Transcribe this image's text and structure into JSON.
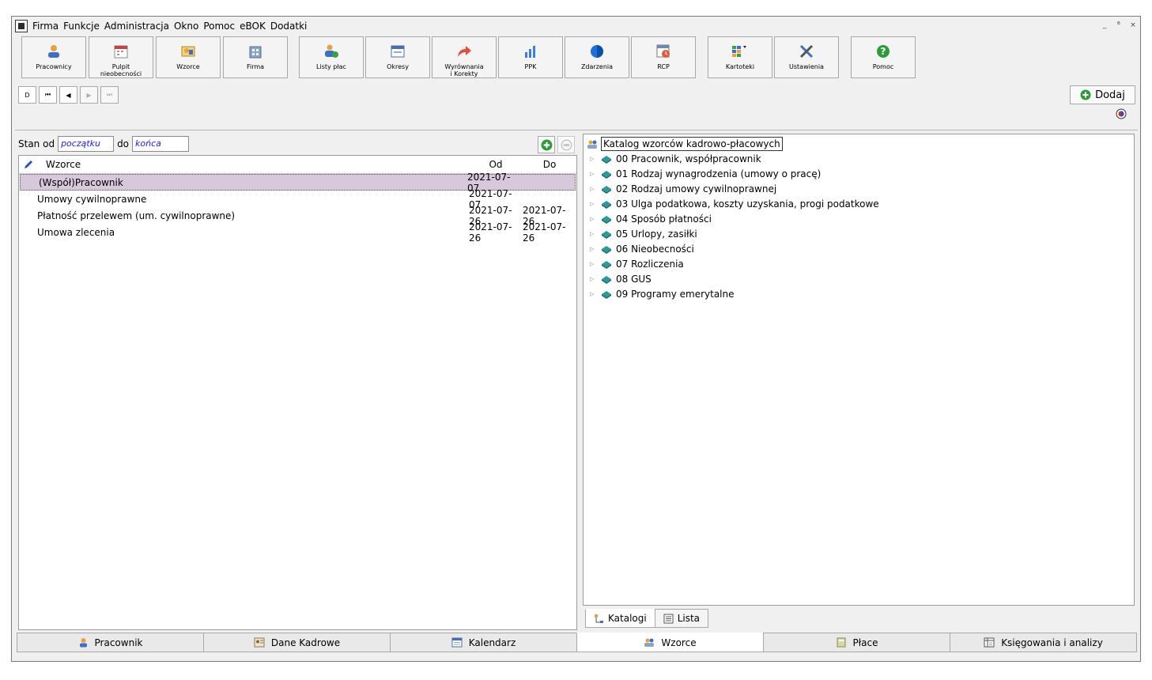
{
  "menu": [
    "Firma",
    "Funkcje",
    "Administracja",
    "Okno",
    "Pomoc",
    "eBOK",
    "Dodatki"
  ],
  "window_controls": [
    "_",
    "ᴮ",
    "×"
  ],
  "toolbar": [
    {
      "label": "Pracownicy",
      "icon": "person-icon"
    },
    {
      "label": "Pulpit\nnieobecności",
      "icon": "calendar-icon"
    },
    {
      "label": "Wzorce",
      "icon": "template-icon"
    },
    {
      "label": "Firma",
      "icon": "building-icon"
    },
    {
      "label": "Listy płac",
      "icon": "payroll-icon"
    },
    {
      "label": "Okresy",
      "icon": "window-icon"
    },
    {
      "label": "Wyrównania\ni Korekty",
      "icon": "redo-arrow-icon"
    },
    {
      "label": "PPK",
      "icon": "bar-chart-icon"
    },
    {
      "label": "Zdarzenia",
      "icon": "globe-icon"
    },
    {
      "label": "RCP",
      "icon": "clock-calendar-icon"
    },
    {
      "label": "Kartoteki",
      "icon": "grid-icon"
    },
    {
      "label": "Ustawienia",
      "icon": "tools-icon"
    },
    {
      "label": "Pomoc",
      "icon": "help-icon"
    }
  ],
  "nav_buttons": [
    "D",
    "⏮",
    "◀",
    "▶",
    "⏭"
  ],
  "dodaj_label": "Dodaj",
  "filter": {
    "from_label": "Stan od",
    "from_value": "początku",
    "to_label": "do",
    "to_value": "końca"
  },
  "grid": {
    "headers": {
      "name": "Wzorce",
      "od": "Od",
      "do": "Do"
    },
    "rows": [
      {
        "name": "(Współ)Pracownik",
        "od": "2021-07-07",
        "do": ""
      },
      {
        "name": "Umowy cywilnoprawne",
        "od": "2021-07-07",
        "do": ""
      },
      {
        "name": "Płatność przelewem (um. cywilnoprawne)",
        "od": "2021-07-26",
        "do": "2021-07-26"
      },
      {
        "name": "Umowa zlecenia",
        "od": "2021-07-26",
        "do": "2021-07-26"
      }
    ]
  },
  "tree": {
    "root": "Katalog wzorców kadrowo-płacowych",
    "items": [
      "00 Pracownik, współpracownik",
      "01 Rodzaj wynagrodzenia (umowy o pracę)",
      "02 Rodzaj umowy cywilnoprawnej",
      "03 Ulga podatkowa, koszty uzyskania, progi podatkowe",
      "04 Sposób płatności",
      "05 Urlopy, zasiłki",
      "06 Nieobecności",
      "07 Rozliczenia",
      "08 GUS",
      "09 Programy emerytalne"
    ]
  },
  "right_tabs": [
    "Katalogi",
    "Lista"
  ],
  "footer_tabs": [
    "Pracownik",
    "Dane Kadrowe",
    "Kalendarz",
    "Wzorce",
    "Płace",
    "Księgowania i analizy"
  ],
  "colors": {
    "selected_row": "#d8c8dc",
    "accent_green": "#2e9b3a",
    "filter_text": "#1a1aff"
  }
}
